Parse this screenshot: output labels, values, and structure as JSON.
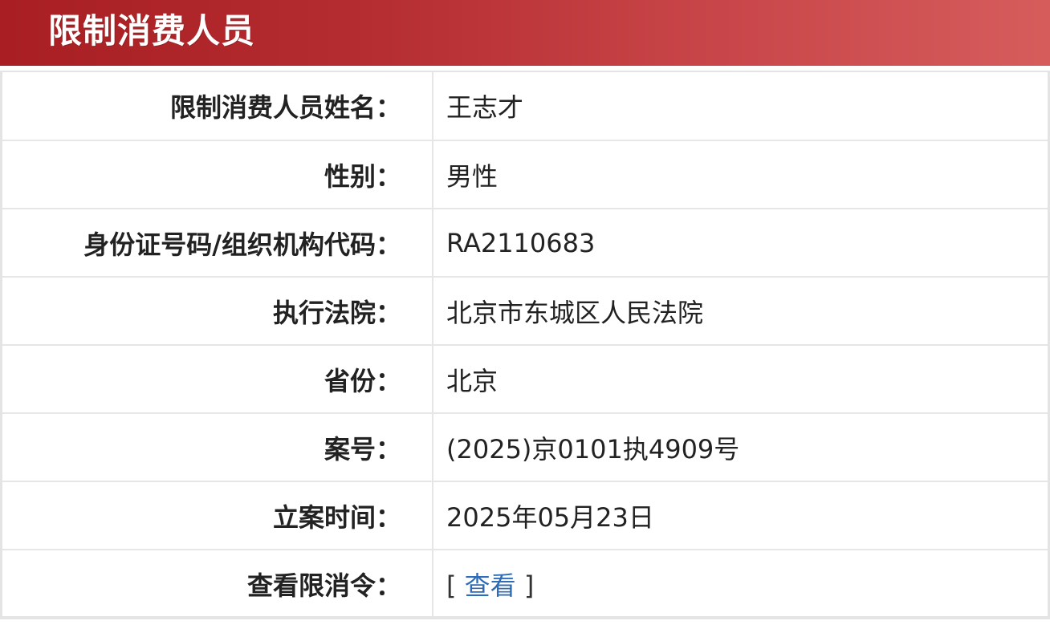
{
  "header": {
    "title": "限制消费人员"
  },
  "rows": [
    {
      "label": "限制消费人员姓名：",
      "value": "王志才"
    },
    {
      "label": "性别：",
      "value": "男性"
    },
    {
      "label": "身份证号码/组织机构代码：",
      "value": "RA2110683"
    },
    {
      "label": "执行法院：",
      "value": "北京市东城区人民法院"
    },
    {
      "label": "省份：",
      "value": "北京"
    },
    {
      "label": "案号：",
      "value": "(2025)京0101执4909号"
    },
    {
      "label": "立案时间：",
      "value": "2025年05月23日"
    },
    {
      "label": "查看限消令：",
      "bracket_open": "[",
      "link": "查看",
      "bracket_close": "]"
    }
  ],
  "colors": {
    "header_bg": "#b52d31",
    "link": "#2f6cb7",
    "border": "#e6e6e6"
  }
}
